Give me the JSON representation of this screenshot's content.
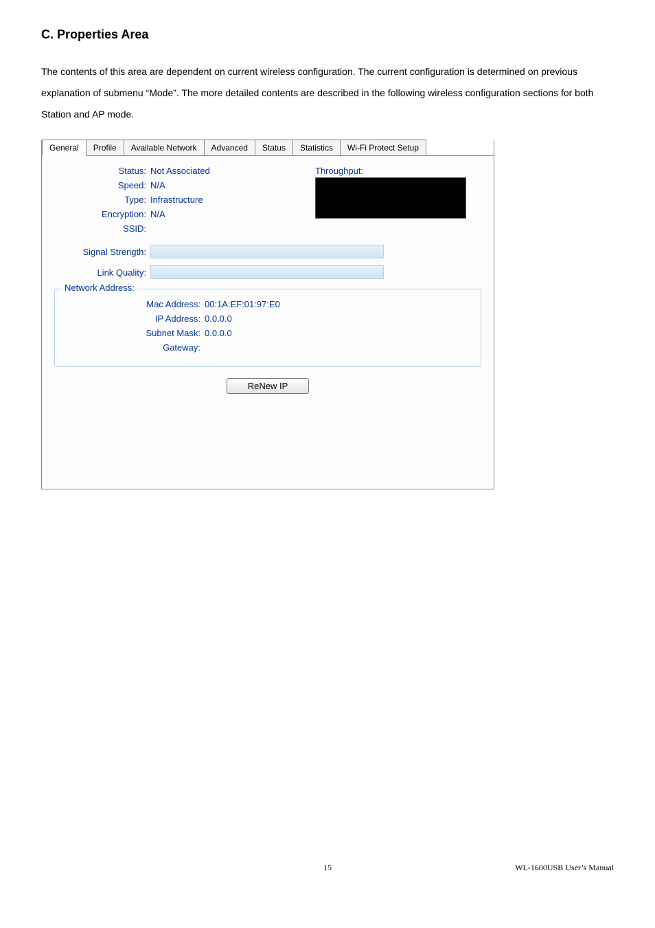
{
  "heading": "C. Properties Area",
  "paragraph": "The contents of this area are dependent on current wireless configuration. The current configuration is determined on previous explanation of submenu “Mode”. The more detailed contents are described in the following wireless configuration sections for both Station and AP mode.",
  "tabs": [
    {
      "label": "General",
      "active": true
    },
    {
      "label": "Profile",
      "active": false
    },
    {
      "label": "Available Network",
      "active": false
    },
    {
      "label": "Advanced",
      "active": false
    },
    {
      "label": "Status",
      "active": false
    },
    {
      "label": "Statistics",
      "active": false
    },
    {
      "label": "Wi-Fi Protect Setup",
      "active": false
    }
  ],
  "status_fields": {
    "status_label": "Status:",
    "status_value": "Not Associated",
    "speed_label": "Speed:",
    "speed_value": "N/A",
    "type_label": "Type:",
    "type_value": "Infrastructure",
    "encryption_label": "Encryption:",
    "encryption_value": "N/A",
    "ssid_label": "SSID:",
    "ssid_value": ""
  },
  "throughput_label": "Throughput:",
  "signal_strength_label": "Signal Strength:",
  "link_quality_label": "Link Quality:",
  "network_address": {
    "legend": "Network Address:",
    "mac_label": "Mac Address:",
    "mac_value": "00:1A:EF:01:97:E0",
    "ip_label": "IP Address:",
    "ip_value": "0.0.0.0",
    "subnet_label": "Subnet Mask:",
    "subnet_value": "0.0.0.0",
    "gateway_label": "Gateway:",
    "gateway_value": ""
  },
  "renew_button": "ReNew IP",
  "footer": {
    "page_number": "15",
    "manual": "WL-1600USB  User’s  Manual"
  }
}
